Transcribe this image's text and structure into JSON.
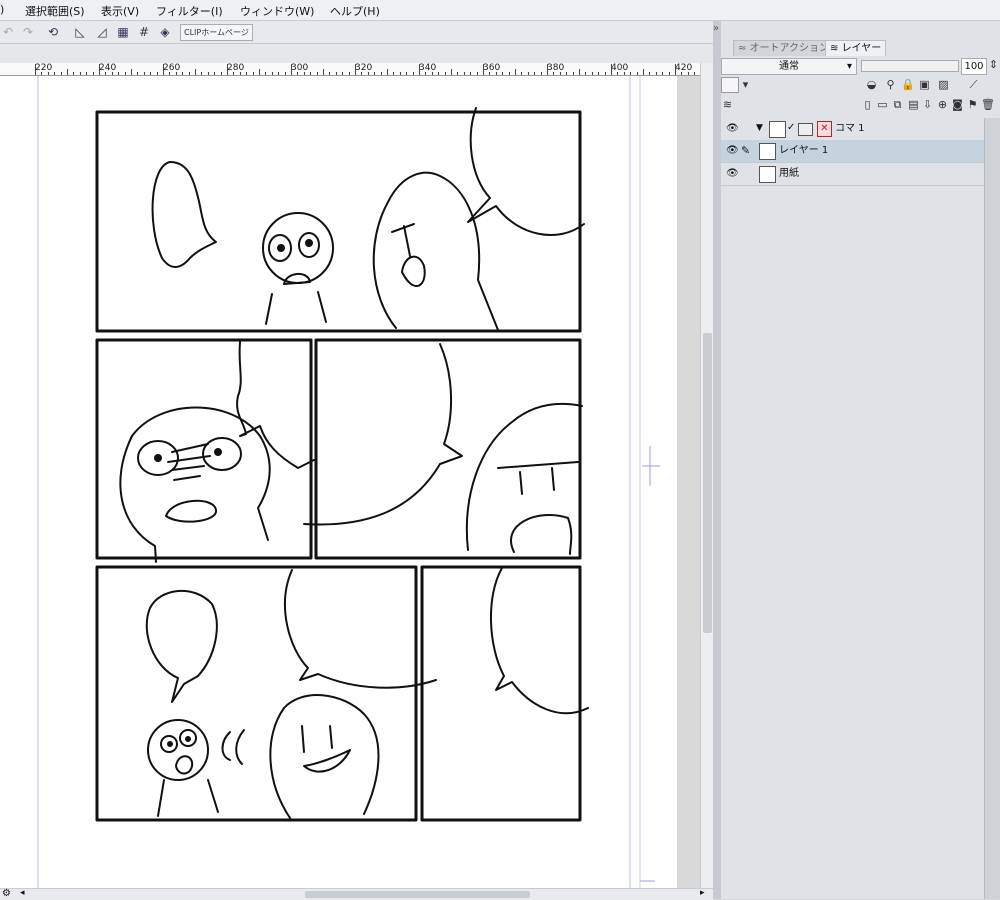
{
  "menubar": {
    "items": [
      {
        "label": ")"
      },
      {
        "label": "選択範囲(S)"
      },
      {
        "label": "表示(V)"
      },
      {
        "label": "フィルター(I)"
      },
      {
        "label": "ウィンドウ(W)"
      },
      {
        "label": "ヘルプ(H)"
      }
    ]
  },
  "toolbar": {
    "clip_home_label": "CLIPホームページ",
    "icons": [
      "undo-icon",
      "redo-icon",
      "transform-icon",
      "ruler-snap-icon",
      "special-ruler-snap-icon",
      "grid-snap-icon",
      "guide-snap-icon",
      "layer-icon"
    ]
  },
  "ruler": {
    "labels": [
      "220",
      "240",
      "260",
      "280",
      "300",
      "320",
      "340",
      "360",
      "380",
      "400",
      "420"
    ]
  },
  "panel": {
    "tabs": [
      {
        "label": "オートアクション",
        "active": false
      },
      {
        "label": "レイヤー",
        "active": true
      }
    ],
    "blend_mode": "通常",
    "opacity": "100",
    "layers": [
      {
        "name": "コマ 1",
        "type": "frame-folder",
        "selected": false
      },
      {
        "name": "レイヤー 1",
        "type": "raster",
        "selected": true
      },
      {
        "name": "用紙",
        "type": "paper",
        "selected": false
      }
    ]
  },
  "colors": {
    "selection": "#c5d3df",
    "panel_bg": "#dfe2e6",
    "canvas_bg": "#d9d9d9",
    "ink": "#111111"
  }
}
